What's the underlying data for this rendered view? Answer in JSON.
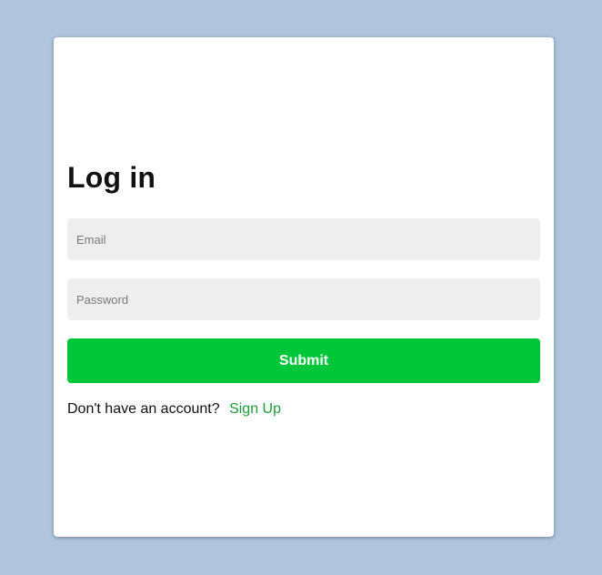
{
  "login": {
    "title": "Log in",
    "email_placeholder": "Email",
    "password_placeholder": "Password",
    "submit_label": "Submit",
    "signup_prompt": "Don't have an account?",
    "signup_link": "Sign Up"
  },
  "colors": {
    "background": "#b0c4de",
    "card": "#ffffff",
    "input_bg": "#eeeeee",
    "submit_bg": "#00c73a",
    "link": "#1f9a3a"
  }
}
